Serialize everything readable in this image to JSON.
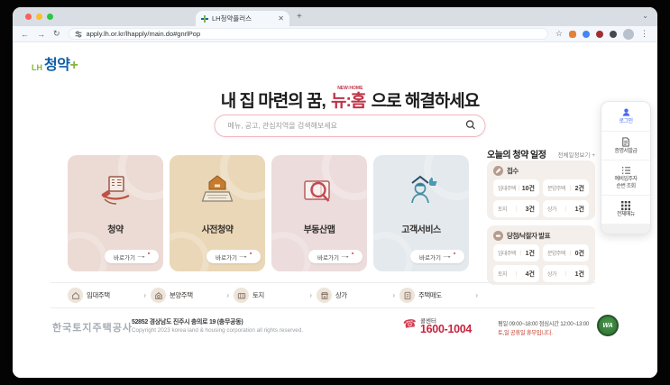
{
  "browser": {
    "tab_title": "LH청약플러스",
    "url": "apply.lh.or.kr/lhapply/main.do#gnrlPop"
  },
  "logo": {
    "lh": "LH",
    "text": "청약",
    "plus": "+"
  },
  "hero": {
    "headline_prefix": "내 집 마련의 꿈,",
    "brand": "뉴:홈",
    "brand_caption": "NEW:HOME",
    "headline_suffix": "으로 해결하세요",
    "search_placeholder": "메뉴, 공고, 관심지역을 검색해보세요"
  },
  "cards": [
    {
      "label": "청약",
      "cta": "바로가기",
      "bg": "#ecdbd5",
      "icon": "hand-building-icon"
    },
    {
      "label": "사전청약",
      "cta": "바로가기",
      "bg": "#ead7b7",
      "icon": "laptop-house-icon"
    },
    {
      "label": "부동산맵",
      "cta": "바로가기",
      "bg": "#ecdcdc",
      "icon": "map-magnifier-icon"
    },
    {
      "label": "고객서비스",
      "cta": "바로가기",
      "bg": "#e4e9ed",
      "icon": "person-thumbsup-icon"
    }
  ],
  "schedule": {
    "title": "오늘의 청약 일정",
    "view_all": "전체일정보기 +",
    "sections": [
      {
        "title": "접수",
        "stats": [
          {
            "label": "임대주택",
            "value": "10건"
          },
          {
            "label": "분양주택",
            "value": "2건"
          },
          {
            "label": "토지",
            "value": "3건"
          },
          {
            "label": "상가",
            "value": "1건"
          }
        ]
      },
      {
        "title": "당첨/낙찰자 발표",
        "stats": [
          {
            "label": "임대주택",
            "value": "1건"
          },
          {
            "label": "분양주택",
            "value": "0건"
          },
          {
            "label": "토지",
            "value": "4건"
          },
          {
            "label": "상가",
            "value": "1건"
          }
        ]
      }
    ]
  },
  "quick_links": [
    {
      "label": "임대주택"
    },
    {
      "label": "분양주택"
    },
    {
      "label": "토지"
    },
    {
      "label": "상가"
    },
    {
      "label": "주택매도"
    }
  ],
  "quick_menu": {
    "items": [
      {
        "label": "로그인"
      },
      {
        "label": "증명서발급"
      },
      {
        "line1": "예비입주자",
        "line2": "순번 조회"
      },
      {
        "label": "전체메뉴"
      }
    ]
  },
  "footer": {
    "company": "한국토지주택공사",
    "address": "52852 경상남도 진주시 충의로 19 (충무공동)",
    "copyright": "Copyright 2023 korea land & housing corporation all rights reserved.",
    "callcenter_label": "콜센터",
    "phone": "1600-1004",
    "hours": "평일 09:00~18:00  점심시간 12:00~13:00",
    "holiday": "토,일 공휴일 휴무입니다.",
    "wa_mark": "WA"
  },
  "colors": {
    "brand_blue": "#0e5ea8",
    "brand_green": "#86b53a",
    "brand_red": "#c03246",
    "phone_red": "#c9243f",
    "schedule_bg": "#f4efeb",
    "search_border": "#efb9c0"
  }
}
